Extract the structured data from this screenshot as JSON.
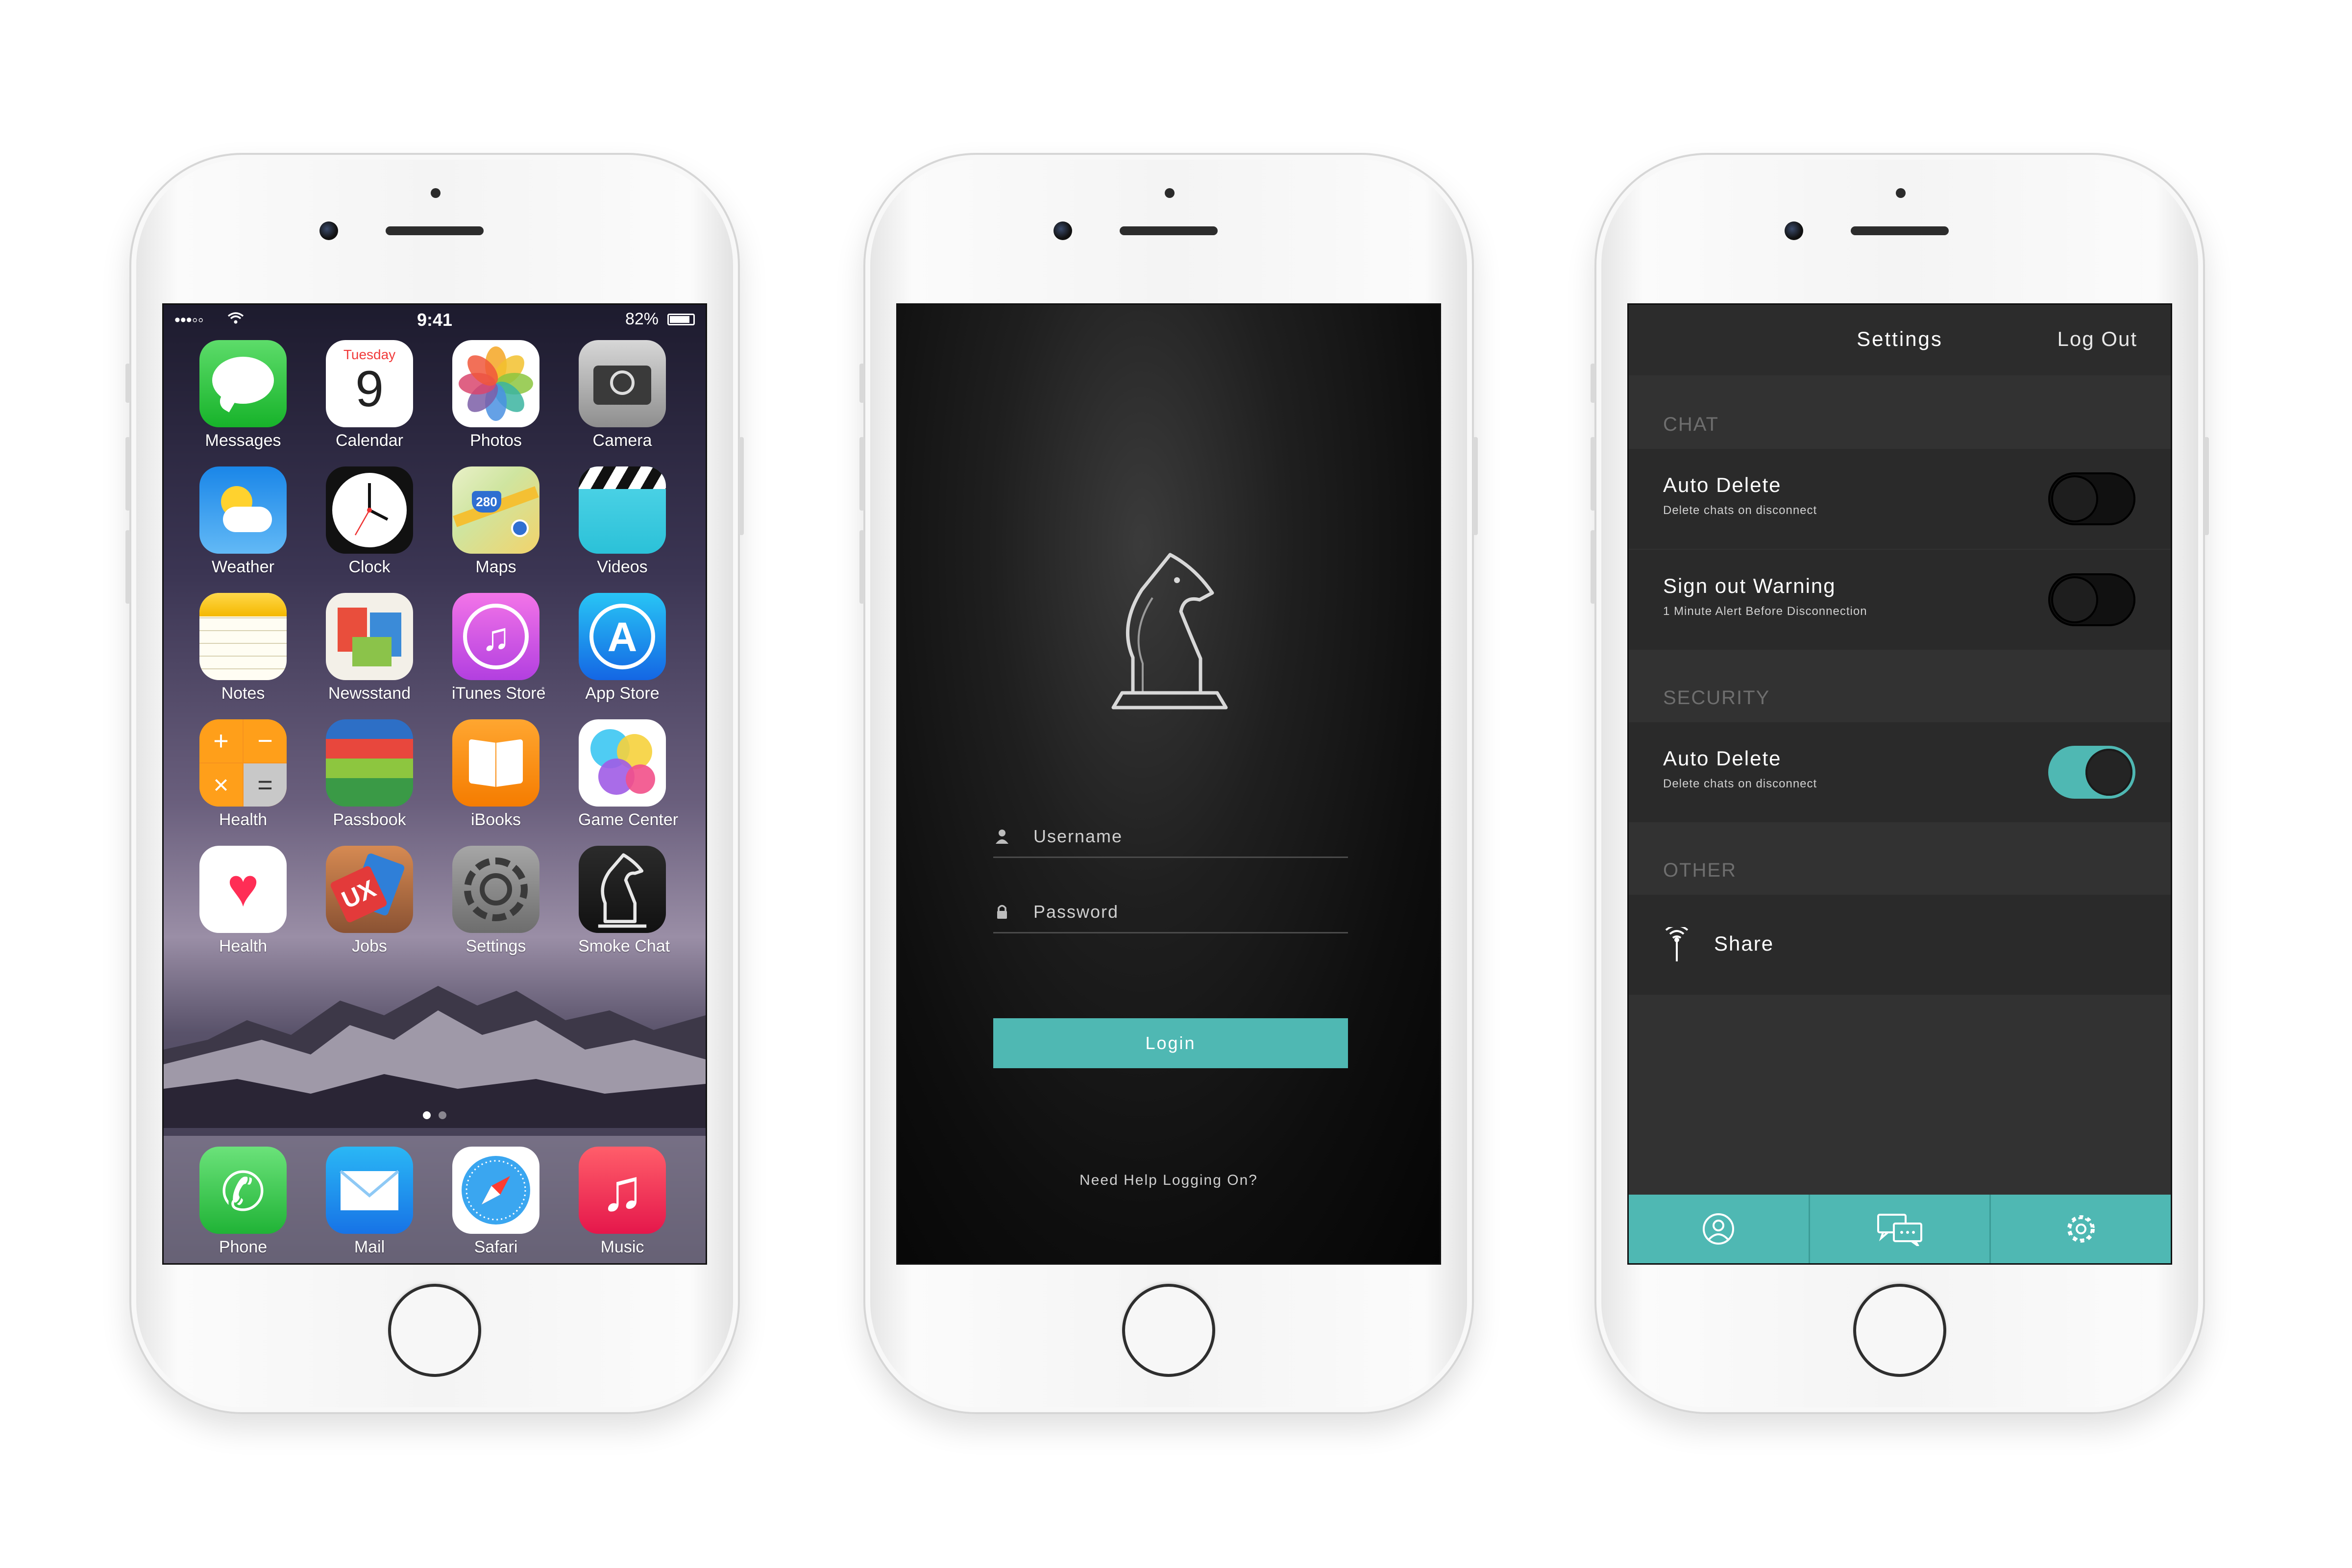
{
  "home_screen": {
    "status": {
      "signal": "•••◦◦",
      "time": "9:41",
      "battery": "82%"
    },
    "apps": [
      {
        "label": "Messages",
        "icon": "messages-icon"
      },
      {
        "label": "Calendar",
        "icon": "calendar-icon",
        "day_name": "Tuesday",
        "day_number": "9"
      },
      {
        "label": "Photos",
        "icon": "photos-icon"
      },
      {
        "label": "Camera",
        "icon": "camera-icon"
      },
      {
        "label": "Weather",
        "icon": "weather-icon"
      },
      {
        "label": "Clock",
        "icon": "clock-icon"
      },
      {
        "label": "Maps",
        "icon": "maps-icon",
        "route": "280"
      },
      {
        "label": "Videos",
        "icon": "videos-icon"
      },
      {
        "label": "Notes",
        "icon": "notes-icon"
      },
      {
        "label": "Newsstand",
        "icon": "newsstand-icon"
      },
      {
        "label": "iTunes Store",
        "icon": "itunes-store-icon"
      },
      {
        "label": "App Store",
        "icon": "app-store-icon"
      },
      {
        "label": "Health",
        "icon": "calculator-icon"
      },
      {
        "label": "Passbook",
        "icon": "passbook-icon"
      },
      {
        "label": "iBooks",
        "icon": "ibooks-icon"
      },
      {
        "label": "Game Center",
        "icon": "game-center-icon"
      },
      {
        "label": "Health",
        "icon": "health-icon"
      },
      {
        "label": "Jobs",
        "icon": "jobs-icon",
        "badge": "UX"
      },
      {
        "label": "Settings",
        "icon": "settings-gear-icon"
      },
      {
        "label": "Smoke Chat",
        "icon": "smoke-chat-knight-icon"
      }
    ],
    "dock": [
      {
        "label": "Phone",
        "icon": "phone-icon"
      },
      {
        "label": "Mail",
        "icon": "mail-icon"
      },
      {
        "label": "Safari",
        "icon": "safari-icon"
      },
      {
        "label": "Music",
        "icon": "music-icon"
      }
    ],
    "page_count": 2,
    "current_page": 1
  },
  "login_screen": {
    "logo": "knight-chess-piece-icon",
    "username_placeholder": "Username",
    "password_placeholder": "Password",
    "login_label": "Login",
    "help_link": "Need Help Logging On?"
  },
  "settings_screen": {
    "title": "Settings",
    "logout_label": "Log Out",
    "sections": [
      {
        "header": "CHAT",
        "rows": [
          {
            "title": "Auto Delete",
            "subtitle": "Delete chats on disconnect",
            "toggle": "off"
          },
          {
            "title": "Sign out Warning",
            "subtitle": "1 Minute Alert Before Disconnection",
            "toggle": "off"
          }
        ]
      },
      {
        "header": "SECURITY",
        "rows": [
          {
            "title": "Auto Delete",
            "subtitle": "Delete chats on disconnect",
            "toggle": "on"
          }
        ]
      },
      {
        "header": "OTHER",
        "rows": [
          {
            "title": "Share",
            "icon": "share-antenna-icon"
          }
        ]
      }
    ],
    "tabs": [
      {
        "icon": "profile-icon"
      },
      {
        "icon": "chat-bubbles-icon"
      },
      {
        "icon": "gear-icon"
      }
    ]
  },
  "colors": {
    "accent_teal": "#4fb8b3",
    "dark_bg": "#323232",
    "row_bg": "#2a2a2a"
  }
}
